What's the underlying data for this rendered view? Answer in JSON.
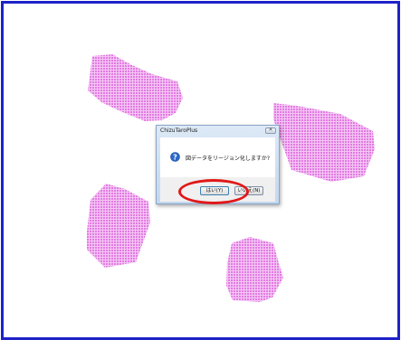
{
  "colors": {
    "frame_border": "#1e22c8",
    "polygon_fill": "#ee82ee",
    "highlight": "#e01818"
  },
  "dialog": {
    "title": "ChizuTaroPlus",
    "close_glyph": "✕",
    "message": "図データをリージョン化しますか?",
    "icon": "question-icon",
    "yes_label": "はい(Y)",
    "no_label": "いいえ(N)"
  }
}
